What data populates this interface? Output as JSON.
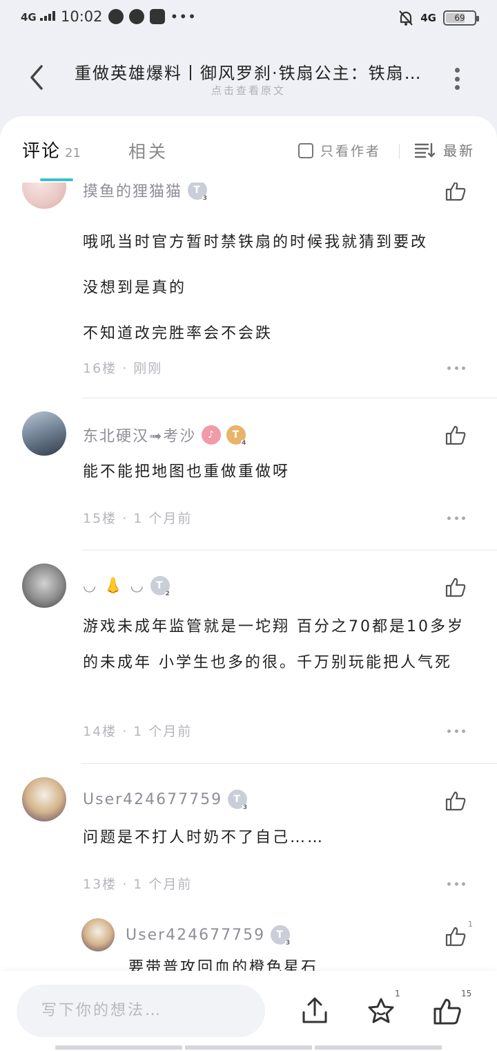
{
  "status_bar": {
    "network": "4G",
    "time": "10:02",
    "dots": "•••",
    "right_network": "4G",
    "battery": "69"
  },
  "header": {
    "title": "重做英雄爆料丨御风罗刹·铁扇公主：铁扇…",
    "subtitle": "点击查看原文"
  },
  "tabs": {
    "comments_label": "评论",
    "comments_count": "21",
    "related_label": "相关",
    "author_only_label": "只看作者",
    "sort_label": "最新"
  },
  "comments": [
    {
      "user": "摸鱼的狸猫猫",
      "badge": "T",
      "badge_level": "3",
      "lines": [
        "哦吼当时官方暂时禁铁扇的时候我就猜到要改",
        "没想到是真的",
        "不知道改完胜率会不会跌"
      ],
      "meta": "16楼 · 刚刚"
    },
    {
      "user": "东北硬汉➟考沙",
      "badge": "T",
      "badge_level": "4",
      "lines": [
        "能不能把地图也重做重做呀"
      ],
      "meta": "15楼 · 1 个月前"
    },
    {
      "user": "◡ 👃 ◡",
      "badge": "T",
      "badge_level": "2",
      "lines": [
        "游戏未成年监管就是一坨翔 百分之70都是10多岁的未成年 小学生也多的很。千万别玩能把人气死"
      ],
      "meta": "14楼 · 1 个月前"
    },
    {
      "user": "User424677759",
      "badge": "T",
      "badge_level": "3",
      "lines": [
        "问题是不打人时奶不了自己……"
      ],
      "meta": "13楼 · 1 个月前"
    }
  ],
  "reply": {
    "user": "User424677759",
    "badge": "T",
    "badge_level": "3",
    "text": "要带普攻回血的橙色星石",
    "like_count": "1"
  },
  "bottom": {
    "placeholder": "写下你的想法…",
    "star_count": "1",
    "like_count": "15"
  }
}
